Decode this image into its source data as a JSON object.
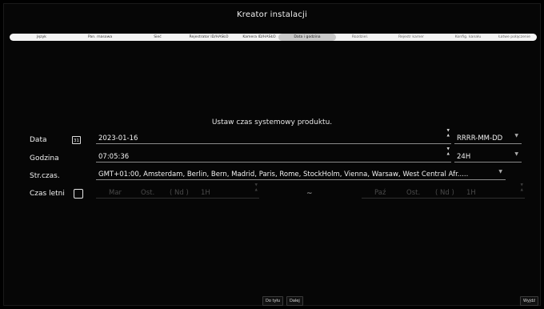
{
  "window": {
    "title": "Kreator instalacji"
  },
  "steps": [
    {
      "label": "Język",
      "active": false
    },
    {
      "label": "Pan. masowa",
      "active": false
    },
    {
      "label": "Sieć",
      "active": false
    },
    {
      "label": "Rejestrator ID/HASŁO",
      "active": false
    },
    {
      "label": "Kamera ID/HASŁO",
      "active": false
    },
    {
      "label": "Data i godzina",
      "active": true
    },
    {
      "label": "Rozdziel.",
      "active": false
    },
    {
      "label": "Rejestr kamer",
      "active": false
    },
    {
      "label": "Konfig. kanału",
      "active": false
    },
    {
      "label": "Łatwe połączenie",
      "active": false
    }
  ],
  "main": {
    "subtitle": "Ustaw czas systemowy produktu.",
    "date": {
      "label": "Data",
      "calendar_icon_text": "31",
      "value": "2023-01-16",
      "format": "RRRR-MM-DD"
    },
    "time": {
      "label": "Godzina",
      "value": "07:05:36",
      "format": "24H"
    },
    "timezone": {
      "label": "Str.czas.",
      "value": "GMT+01:00, Amsterdam, Berlin, Bern, Madrid, Paris, Rome, StockHolm, Vienna, Warsaw, West Central Afr....."
    },
    "dst": {
      "label": "Czas letni",
      "checked": false,
      "start": {
        "month": "Mar",
        "week": "Ost.",
        "day": "( Nd )",
        "hour": "1H"
      },
      "separator": "~",
      "end": {
        "month": "Paź",
        "week": "Ost.",
        "day": "( Nd )",
        "hour": "1H"
      }
    }
  },
  "footer": {
    "back_label": "Do tyłu",
    "next_label": "Dalej",
    "exit_label": "Wyjdź"
  }
}
